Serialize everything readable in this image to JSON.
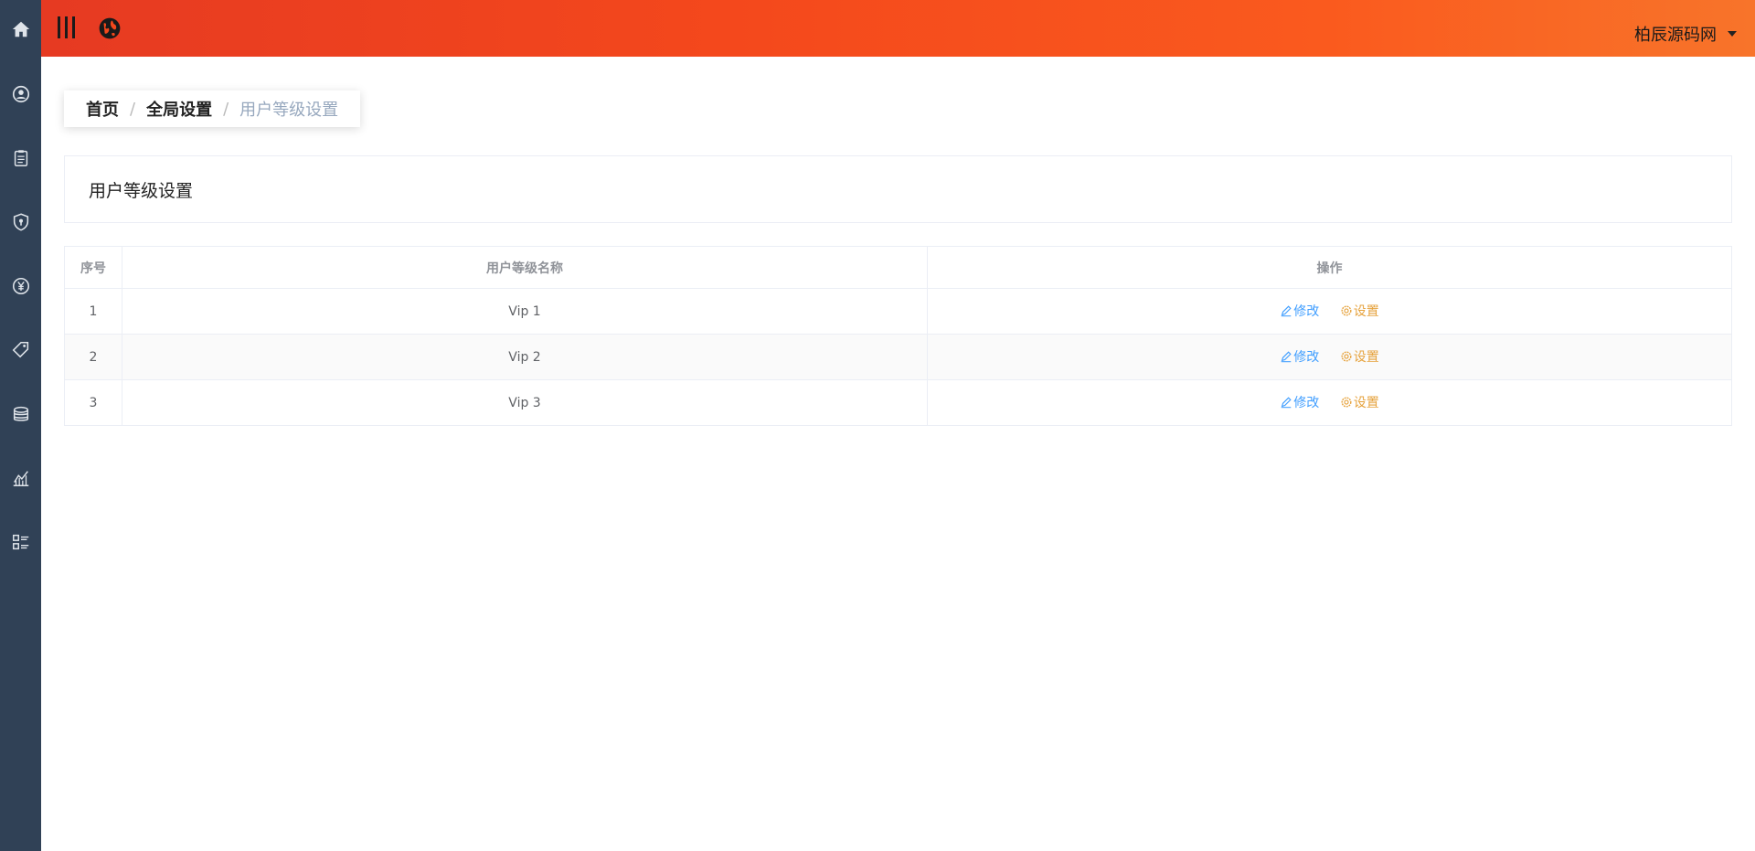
{
  "sidebar": {
    "items": [
      {
        "icon": "home-icon"
      },
      {
        "icon": "user-icon"
      },
      {
        "icon": "clipboard-icon"
      },
      {
        "icon": "shield-icon"
      },
      {
        "icon": "yen-icon"
      },
      {
        "icon": "tag-icon"
      },
      {
        "icon": "coins-icon"
      },
      {
        "icon": "chart-icon"
      },
      {
        "icon": "list-icon"
      }
    ]
  },
  "topbar": {
    "menu_icon": "menu-toggle-icon",
    "globe_icon": "globe-icon",
    "username": "柏辰源码网"
  },
  "breadcrumb": {
    "home": "首页",
    "section": "全局设置",
    "current": "用户等级设置",
    "separator": "/"
  },
  "page": {
    "title": "用户等级设置"
  },
  "table": {
    "headers": {
      "index": "序号",
      "name": "用户等级名称",
      "actions": "操作"
    },
    "rows": [
      {
        "index": "1",
        "name": "Vip 1",
        "edit": "修改",
        "settings": "设置"
      },
      {
        "index": "2",
        "name": "Vip 2",
        "edit": "修改",
        "settings": "设置"
      },
      {
        "index": "3",
        "name": "Vip 3",
        "edit": "修改",
        "settings": "设置"
      }
    ]
  },
  "colors": {
    "sidebar_bg": "#304156",
    "topbar_start": "#e63a22",
    "topbar_end": "#f8742a",
    "link_blue": "#409eff",
    "link_orange": "#e6a23c"
  }
}
